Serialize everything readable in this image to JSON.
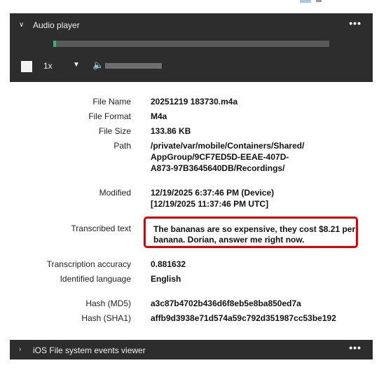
{
  "audio_player": {
    "title": "Audio player",
    "more": "•••",
    "progress": 0.01,
    "speed": "1x",
    "volume": 1.0
  },
  "properties": [
    {
      "label": "File Name",
      "value": "20251219 183730.m4a"
    },
    {
      "label": "File Format",
      "value": "M4a"
    },
    {
      "label": "File Size",
      "value": "133.86 KB"
    },
    {
      "label": "Path",
      "value_lines": [
        "/private/var/mobile/Containers/Shared/",
        "AppGroup/9CF7ED5D-EEAE-407D-",
        "A873-97B3645640DB/Recordings/"
      ]
    },
    {
      "label": "Modified",
      "value_lines": [
        "12/19/2025 6:37:46 PM (Device)",
        "[12/19/2025 11:37:46 PM UTC]"
      ]
    },
    {
      "label": "Transcribed text",
      "value_lines": [
        "The bananas are so expensive, they cost $8.21 per",
        "banana. Dorian, answer me right now."
      ]
    },
    {
      "label": "Transcription accuracy",
      "value": "0.881632"
    },
    {
      "label": "Identified language",
      "value": "English"
    },
    {
      "label": "Hash (MD5)",
      "value": "a3c87b4702b436d6f8eb5e8ba850ed7a"
    },
    {
      "label": "Hash (SHA1)",
      "value": "affb9d3938e71d574a59c792d351987cc53be192"
    }
  ],
  "events_viewer": {
    "title": "iOS File system events viewer",
    "more": "•••"
  },
  "colors": {
    "panel": "#2d2d2d",
    "highlight": "#e00000",
    "progress": "#3cb371"
  }
}
